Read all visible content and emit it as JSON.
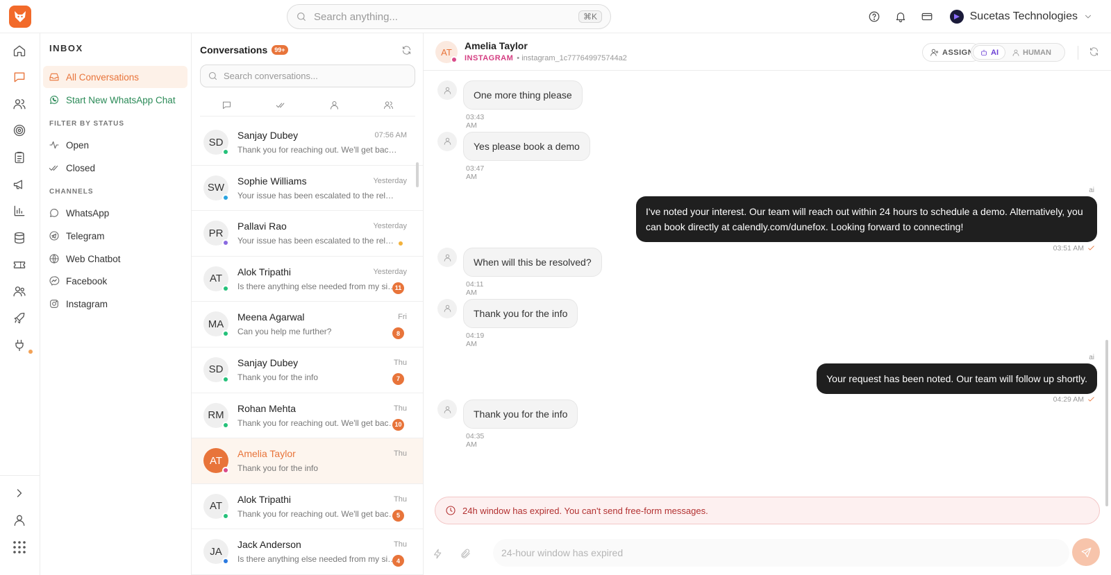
{
  "topbar": {
    "search_placeholder": "Search anything...",
    "shortcut": "⌘K",
    "org_name": "Sucetas Technologies"
  },
  "sidebar": {
    "title": "INBOX",
    "items": [
      {
        "label": "All Conversations"
      },
      {
        "label": "Start New WhatsApp Chat"
      }
    ],
    "filter_label": "FILTER BY STATUS",
    "filters": [
      {
        "label": "Open"
      },
      {
        "label": "Closed"
      }
    ],
    "channels_label": "CHANNELS",
    "channels": [
      {
        "label": "WhatsApp"
      },
      {
        "label": "Telegram"
      },
      {
        "label": "Web Chatbot"
      },
      {
        "label": "Facebook"
      },
      {
        "label": "Instagram"
      }
    ]
  },
  "conversations": {
    "title": "Conversations",
    "count": "99+",
    "search_placeholder": "Search conversations...",
    "items": [
      {
        "initials": "SD",
        "name": "Sanjay Dubey",
        "time": "07:56 AM",
        "preview": "Thank you for reaching out. We'll get back to you shortly.",
        "badge": "",
        "channel_color": "#25c17a"
      },
      {
        "initials": "SW",
        "name": "Sophie Williams",
        "time": "Yesterday",
        "preview": "Your issue has been escalated to the relevant team.",
        "badge": "",
        "channel_color": "#2aa3e0"
      },
      {
        "initials": "PR",
        "name": "Pallavi Rao",
        "time": "Yesterday",
        "preview": "Your issue has been escalated to the relevant team.",
        "badge": "",
        "channel_color": "#8a6ae0"
      },
      {
        "initials": "AT",
        "name": "Alok Tripathi",
        "time": "Yesterday",
        "preview": "Is there anything else needed from my side?",
        "badge": "11",
        "channel_color": "#25c17a"
      },
      {
        "initials": "MA",
        "name": "Meena Agarwal",
        "time": "Fri",
        "preview": "Can you help me further?",
        "badge": "8",
        "channel_color": "#25c17a"
      },
      {
        "initials": "SD",
        "name": "Sanjay Dubey",
        "time": "Thu",
        "preview": "Thank you for the info",
        "badge": "7",
        "channel_color": "#25c17a"
      },
      {
        "initials": "RM",
        "name": "Rohan Mehta",
        "time": "Thu",
        "preview": "Thank you for reaching out. We'll get back to you shortly.",
        "badge": "10",
        "channel_color": "#25c17a"
      },
      {
        "initials": "AT",
        "name": "Amelia Taylor",
        "time": "Thu",
        "preview": "Thank you for the info",
        "badge": "",
        "channel_color": "#d94b8a"
      },
      {
        "initials": "AT",
        "name": "Alok Tripathi",
        "time": "Thu",
        "preview": "Thank you for reaching out. We'll get back to you shortly.",
        "badge": "5",
        "channel_color": "#25c17a"
      },
      {
        "initials": "JA",
        "name": "Jack Anderson",
        "time": "Thu",
        "preview": "Is there anything else needed from my side?",
        "badge": "4",
        "channel_color": "#2a7ae0"
      }
    ]
  },
  "chat": {
    "contact_initials": "AT",
    "contact_name": "Amelia Taylor",
    "platform": "INSTAGRAM",
    "handle": "• instagram_1c777649975744a2",
    "assign_label": "ASSIGN",
    "ai_label": "AI",
    "human_label": "HUMAN",
    "ai_tag": "ai",
    "messages": [
      {
        "dir": "in",
        "text": "One more thing please",
        "time": "03:43 AM"
      },
      {
        "dir": "in",
        "text": "Yes please book a demo",
        "time": "03:47 AM"
      },
      {
        "dir": "out",
        "text": "I've noted your interest. Our team will reach out within 24 hours to schedule a demo. Alternatively, you can book directly at calendly.com/dunefox. Looking forward to connecting!",
        "time": "03:51 AM"
      },
      {
        "dir": "in",
        "text": "When will this be resolved?",
        "time": "04:11 AM"
      },
      {
        "dir": "in",
        "text": "Thank you for the info",
        "time": "04:19 AM"
      },
      {
        "dir": "out",
        "text": "Your request has been noted. Our team will follow up shortly.",
        "time": "04:29 AM"
      },
      {
        "dir": "in",
        "text": "Thank you for the info",
        "time": "04:35 AM"
      }
    ],
    "expired_notice": "24h window has expired. You can't send free-form messages.",
    "input_placeholder": "24-hour window has expired"
  },
  "colors": {
    "accent": "#e8743a",
    "instagram": "#d43e82",
    "ai": "#6b3fd4"
  }
}
